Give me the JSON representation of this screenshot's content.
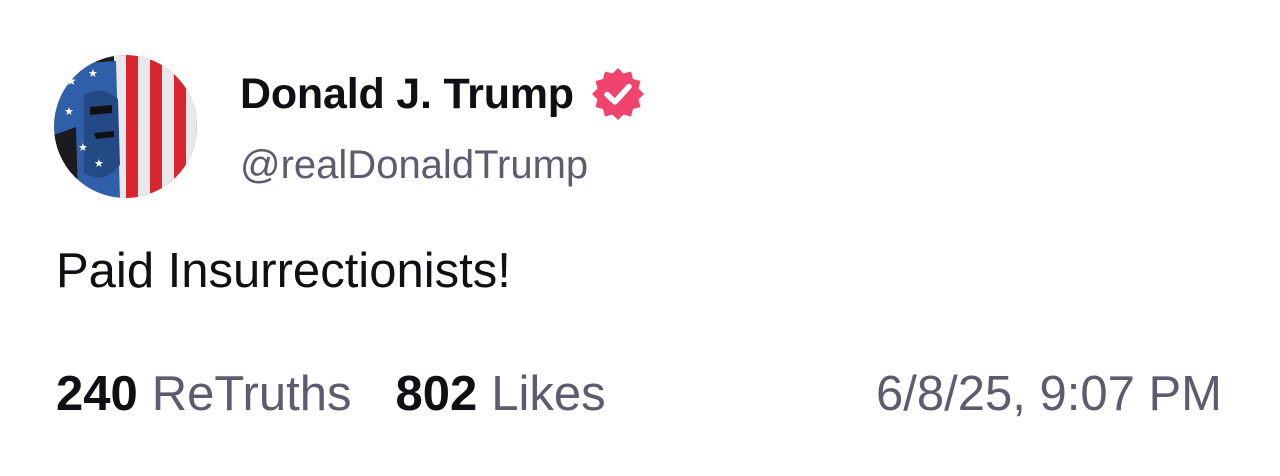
{
  "author": {
    "display_name": "Donald J. Trump",
    "handle": "@realDonaldTrump",
    "avatar_icon": "flag-face-avatar",
    "verified_icon": "verified-badge-icon"
  },
  "post": {
    "text": "Paid Insurrectionists!"
  },
  "stats": {
    "retruths_count": "240",
    "retruths_label": "ReTruths",
    "likes_count": "802",
    "likes_label": "Likes"
  },
  "timestamp": "6/8/25, 9:07 PM",
  "colors": {
    "text_primary": "#0f0f14",
    "text_secondary": "#5c5c6e",
    "verified_badge": "#f0446e",
    "background": "#ffffff"
  }
}
